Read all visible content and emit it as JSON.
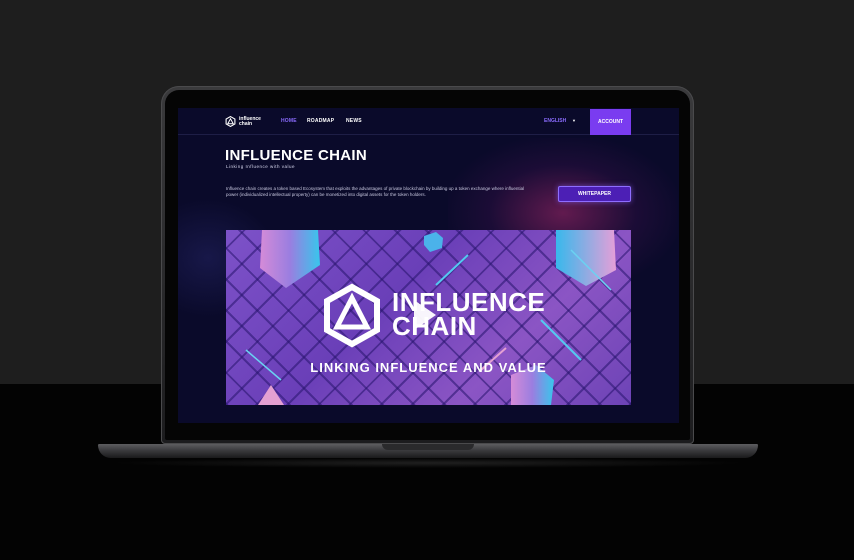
{
  "nav": {
    "logo_text": "influence chain",
    "links": [
      "HOME",
      "ROADMAP",
      "NEWS"
    ],
    "language": "ENGLISH",
    "account_label": "ACCOUNT"
  },
  "hero": {
    "title": "INFLUENCE CHAIN",
    "subtitle": "Linking Influence with value",
    "description": "Influence chain creates a token based Ecosystem that exploits the advantages of private blockchain by building up a token exchange where influential power (individualized intellectual property) can be monetized into digital assets for the token holders.",
    "whitepaper_label": "WHITEPAPER"
  },
  "video": {
    "banner_title_line1": "INFLUENCE",
    "banner_title_line2": "CHAIN",
    "tagline": "LINKING INFLUENCE AND VALUE"
  },
  "colors": {
    "accent": "#7a3cf0",
    "active_link": "#8b6cff",
    "screen_bg": "#0a0a2a"
  },
  "icons": [
    "logo-icon",
    "caret-down-icon",
    "play-icon"
  ]
}
